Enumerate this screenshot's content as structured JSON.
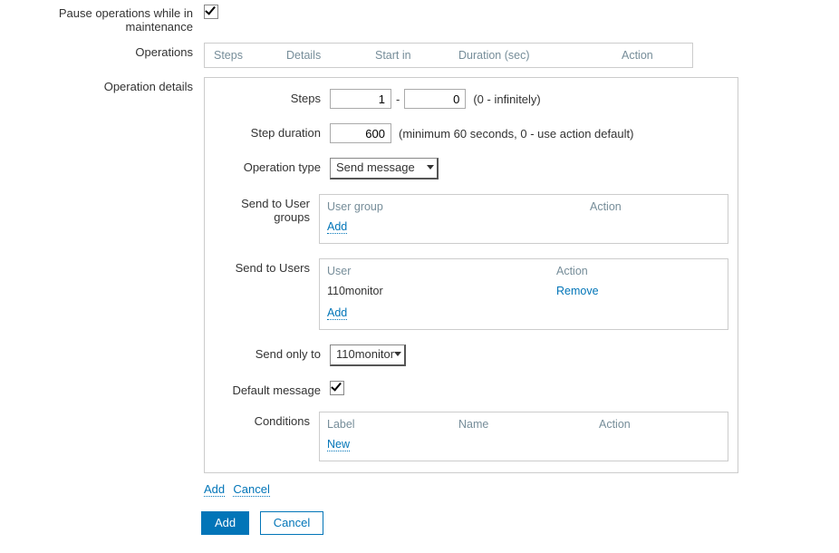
{
  "labels": {
    "pause_ops": "Pause operations while in maintenance",
    "operations": "Operations",
    "operation_details": "Operation details",
    "steps": "Steps",
    "step_duration": "Step duration",
    "operation_type": "Operation type",
    "send_user_groups": "Send to User groups",
    "send_users": "Send to Users",
    "send_only_to": "Send only to",
    "default_message": "Default message",
    "conditions": "Conditions"
  },
  "ops_headers": {
    "steps": "Steps",
    "details": "Details",
    "start_in": "Start in",
    "duration": "Duration (sec)",
    "action": "Action"
  },
  "steps": {
    "from": "1",
    "to": "0",
    "hint": "(0 - infinitely)"
  },
  "step_duration": {
    "value": "600",
    "hint": "(minimum 60 seconds, 0 - use action default)"
  },
  "operation_type": {
    "value": "Send message"
  },
  "user_groups": {
    "headers": {
      "group": "User group",
      "action": "Action"
    },
    "add": "Add"
  },
  "users": {
    "headers": {
      "user": "User",
      "action": "Action"
    },
    "rows": [
      {
        "name": "110monitor",
        "action": "Remove"
      }
    ],
    "add": "Add"
  },
  "send_only_to": {
    "value": "110monitor"
  },
  "conditions": {
    "headers": {
      "label": "Label",
      "name": "Name",
      "action": "Action"
    },
    "new": "New"
  },
  "inline": {
    "add": "Add",
    "cancel": "Cancel"
  },
  "buttons": {
    "add": "Add",
    "cancel": "Cancel"
  }
}
